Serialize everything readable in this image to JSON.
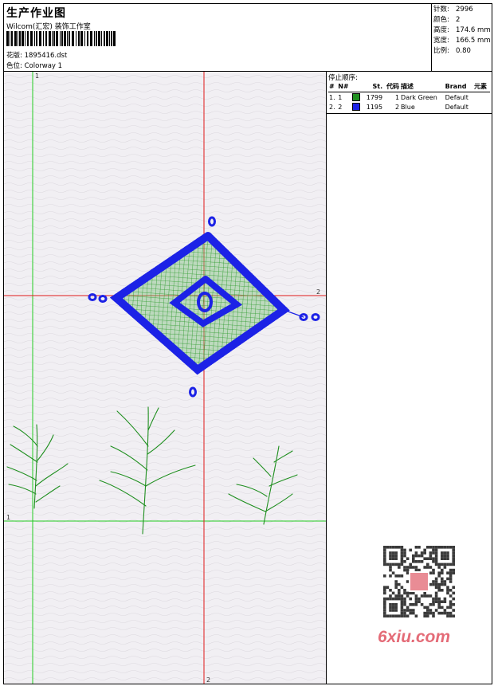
{
  "header": {
    "title": "生产作业图",
    "studio": "Wilcom(汇宏) 装饰工作室",
    "design_label": "花版:",
    "design_file": "1895416.dst",
    "colorway_label": "色位:",
    "colorway": "Colorway 1"
  },
  "stats": [
    {
      "label": "针数:",
      "value": "2996"
    },
    {
      "label": "颜色:",
      "value": "2"
    },
    {
      "label": "高度:",
      "value": "174.6 mm"
    },
    {
      "label": "宽度:",
      "value": "166.5 mm"
    },
    {
      "label": "比例:",
      "value": "0.80"
    }
  ],
  "stop_sequence": {
    "title": "停止顺序:",
    "columns": [
      "#",
      "N#",
      "St.",
      "代码",
      "描述",
      "Brand",
      "元素"
    ],
    "rows": [
      {
        "num": "1.",
        "needle": "1",
        "color": "#1f8f1f",
        "stitches": "1799",
        "code": "1",
        "description": "Dark Green",
        "brand": "Default",
        "element": ""
      },
      {
        "num": "2.",
        "needle": "2",
        "color": "#1c22e6",
        "stitches": "1195",
        "code": "2",
        "description": "Blue",
        "brand": "Default",
        "element": ""
      }
    ]
  },
  "axes": {
    "horizontal_red_label": "2",
    "vertical_red_label": "2",
    "vertical_green_label": "1",
    "horizontal_green_label": "1"
  },
  "colors": {
    "green": "#1f8f1f",
    "blue": "#1c22e6",
    "red_guide": "#e01818",
    "green_guide": "#22cc22",
    "canvas_bg": "#f1eff3"
  },
  "watermark": {
    "text": "6xiu.com",
    "icon": "qr-code-icon"
  }
}
